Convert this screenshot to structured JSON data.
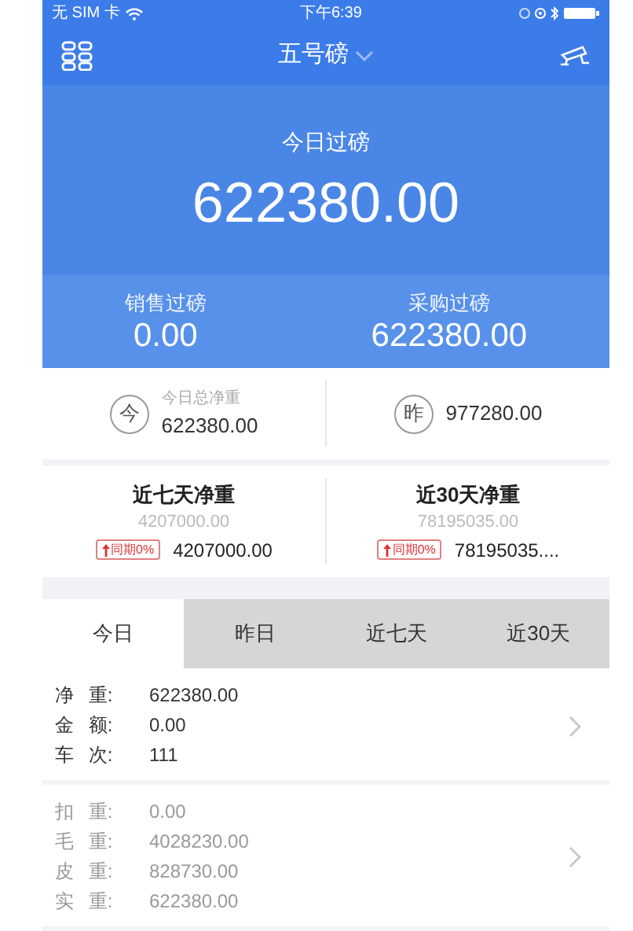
{
  "status_bar": {
    "carrier": "无 SIM 卡",
    "time": "下午6:39"
  },
  "nav": {
    "title": "五号磅"
  },
  "hero": {
    "label": "今日过磅",
    "value": "622380.00"
  },
  "sub_stats": [
    {
      "label": "销售过磅",
      "value": "0.00"
    },
    {
      "label": "采购过磅",
      "value": "622380.00"
    }
  ],
  "day_summary": [
    {
      "badge": "今",
      "label": "今日总净重",
      "value": "622380.00"
    },
    {
      "badge": "昨",
      "value": "977280.00"
    }
  ],
  "period_summary": [
    {
      "title": "近七天净重",
      "reference": "4207000.00",
      "trend": "同期0%",
      "value": "4207000.00"
    },
    {
      "title": "近30天净重",
      "reference": "78195035.00",
      "trend": "同期0%",
      "value": "78195035...."
    }
  ],
  "tabs": [
    {
      "label": "今日",
      "selected": true
    },
    {
      "label": "昨日",
      "selected": false
    },
    {
      "label": "近七天",
      "selected": false
    },
    {
      "label": "近30天",
      "selected": false
    }
  ],
  "detail_groups": [
    {
      "muted": false,
      "rows": [
        {
          "label": "净 重:",
          "value": "622380.00"
        },
        {
          "label": "金 额:",
          "value": "0.00"
        },
        {
          "label": "车 次:",
          "value": "111"
        }
      ]
    },
    {
      "muted": true,
      "rows": [
        {
          "label": "扣 重:",
          "value": "0.00"
        },
        {
          "label": "毛 重:",
          "value": "4028230.00"
        },
        {
          "label": "皮 重:",
          "value": "828730.00"
        },
        {
          "label": "实 重:",
          "value": "622380.00"
        }
      ]
    }
  ]
}
